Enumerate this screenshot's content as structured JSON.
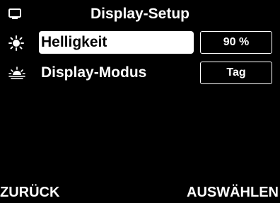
{
  "header": {
    "title": "Display-Setup",
    "icon": "monitor-icon"
  },
  "menu": {
    "items": [
      {
        "label": "Helligkeit",
        "value": "90 %",
        "icon": "sun-icon",
        "selected": true
      },
      {
        "label": "Display-Modus",
        "value": "Tag",
        "icon": "sunset-icon",
        "selected": false
      }
    ]
  },
  "softkeys": {
    "left": "ZURÜCK",
    "right": "AUSWÄHLEN"
  }
}
